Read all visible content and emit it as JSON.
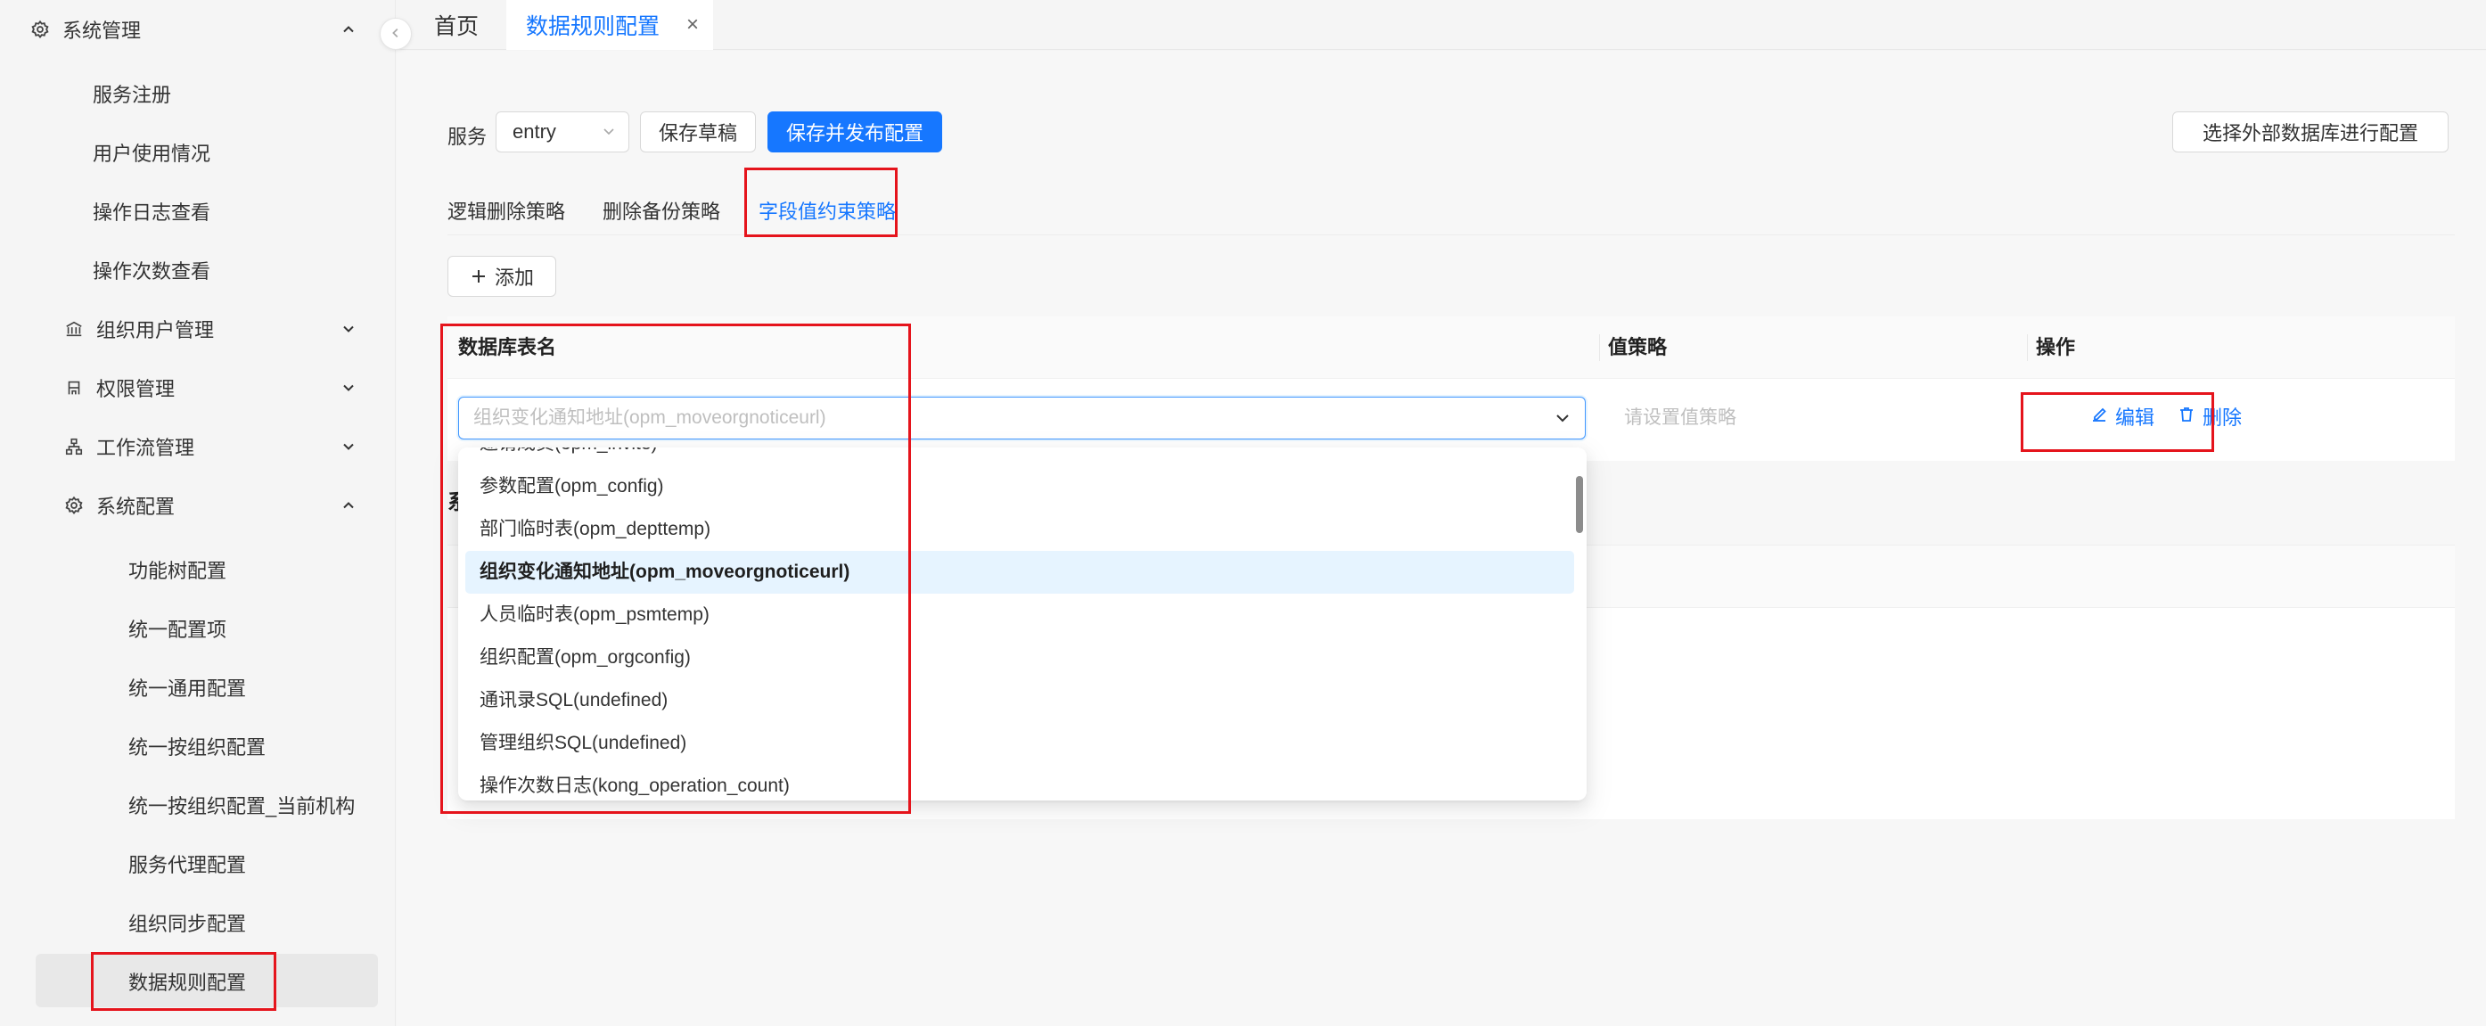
{
  "sidebar": {
    "top": {
      "label": "系统管理"
    },
    "items_sub1": [
      "服务注册",
      "用户使用情况",
      "操作日志查看",
      "操作次数查看"
    ],
    "groups": [
      {
        "label": "组织用户管理",
        "icon": "bank-icon"
      },
      {
        "label": "权限管理",
        "icon": "user-flag-icon"
      },
      {
        "label": "工作流管理",
        "icon": "workflow-icon"
      },
      {
        "label": "系统配置",
        "icon": "gear-icon"
      }
    ],
    "items_sub2": [
      "功能树配置",
      "统一配置项",
      "统一通用配置",
      "统一按组织配置",
      "统一按组织配置_当前机构",
      "服务代理配置",
      "组织同步配置",
      "数据规则配置"
    ]
  },
  "tabs": {
    "home": "首页",
    "active": "数据规则配置",
    "close": "×"
  },
  "toolbar": {
    "service_label": "服务",
    "service_value": "entry",
    "save_draft": "保存草稿",
    "save_publish": "保存并发布配置",
    "external_db": "选择外部数据库进行配置"
  },
  "subtabs": [
    "逻辑删除策略",
    "删除备份策略",
    "字段值约束策略"
  ],
  "add_button": "添加",
  "table": {
    "headers": {
      "name": "数据库表名",
      "strategy": "值策略",
      "action": "操作"
    },
    "row": {
      "table_placeholder": "组织变化通知地址(opm_moveorgnoticeurl)",
      "strategy_placeholder": "请设置值策略",
      "edit": "编辑",
      "delete": "删除"
    }
  },
  "section2_title_partial": "系",
  "dropdown_options": [
    "邀请成员(opm_invite)",
    "参数配置(opm_config)",
    "部门临时表(opm_depttemp)",
    "组织变化通知地址(opm_moveorgnoticeurl)",
    "人员临时表(opm_psmtemp)",
    "组织配置(opm_orgconfig)",
    "通讯录SQL(undefined)",
    "管理组织SQL(undefined)",
    "操作次数日志(kong_operation_count)"
  ],
  "dropdown_selected_index": 3,
  "colors": {
    "primary": "#1677ff",
    "highlight": "#e5141c"
  }
}
